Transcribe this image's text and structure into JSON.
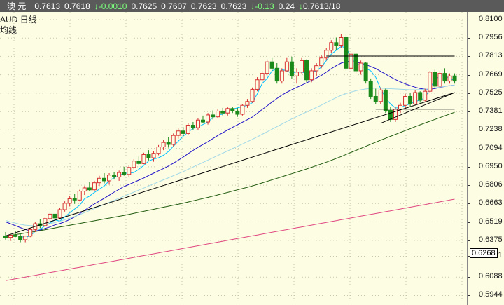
{
  "topbar": {
    "symbol": "澳 元",
    "values": [
      "0.7613",
      "0.7618"
    ],
    "change": "-0.0010",
    "values2": [
      "0.7625",
      "0.7607",
      "0.7623",
      "0.7623"
    ],
    "change2": "-0.13",
    "pct": "0.24",
    "last": "0.7613/18"
  },
  "legend": {
    "line1": "AUD 日线",
    "line2": "均线"
  },
  "colors": {
    "background": "#fdfde4",
    "grid": "#c8c8a8",
    "up": "#d83030",
    "down": "#1a8a1a",
    "ma_fast": "#00c0ff",
    "ma_mid": "#1e10c8",
    "ma_light": "#9fd8e8",
    "ma_slow": "#225c10",
    "ma_longest": "#e04880"
  },
  "current_price": "0.6268",
  "chart_data": {
    "type": "candlestick",
    "yaxis": {
      "ticks": [
        "0.8100",
        "0.7956",
        "0.7813",
        "0.7669",
        "0.7525",
        "0.7381",
        "0.7238",
        "0.7094",
        "0.6950",
        "0.6806",
        "0.6663",
        "0.6519",
        "0.6375",
        "0.6251",
        "0.6088",
        "0.5944"
      ],
      "range": [
        0.587,
        0.816
      ]
    },
    "series": [
      {
        "values": [
          0.6402,
          0.6408,
          0.6415,
          0.6405,
          0.6398,
          0.641,
          0.6445,
          0.646,
          0.649,
          0.651,
          0.6535,
          0.6525,
          0.656,
          0.659,
          0.662,
          0.665,
          0.67,
          0.672,
          0.675,
          0.6775,
          0.68,
          0.684,
          0.6865,
          0.688,
          0.69,
          0.69,
          0.6905,
          0.693,
          0.696,
          0.6995,
          0.701,
          0.702,
          0.704,
          0.707,
          0.711,
          0.715,
          0.719,
          0.722,
          0.725,
          0.726,
          0.728,
          0.73,
          0.7335,
          0.7355,
          0.736,
          0.739,
          0.74,
          0.741,
          0.742,
          0.743,
          0.745,
          0.752,
          0.76,
          0.764,
          0.77,
          0.772,
          0.771,
          0.77,
          0.768,
          0.769,
          0.769,
          0.768,
          0.769,
          0.77,
          0.773,
          0.778,
          0.783,
          0.786,
          0.789,
          0.788,
          0.781,
          0.776,
          0.774,
          0.772,
          0.77,
          0.765,
          0.756,
          0.749,
          0.744,
          0.741,
          0.741,
          0.743,
          0.744,
          0.746,
          0.747,
          0.749,
          0.756,
          0.763,
          0.766,
          0.766,
          0.764,
          0.7625
        ]
      },
      {
        "values": [
          0.652,
          0.6505,
          0.649,
          0.6475,
          0.646,
          0.645,
          0.6448,
          0.6455,
          0.6468,
          0.648,
          0.6496,
          0.6506,
          0.652,
          0.6538,
          0.6558,
          0.6582,
          0.661,
          0.6635,
          0.666,
          0.6682,
          0.6704,
          0.6728,
          0.6752,
          0.6774,
          0.6796,
          0.6812,
          0.6828,
          0.6845,
          0.6862,
          0.6882,
          0.69,
          0.6918,
          0.6936,
          0.6956,
          0.6978,
          0.7002,
          0.7026,
          0.7052,
          0.7078,
          0.7102,
          0.7124,
          0.7146,
          0.717,
          0.7194,
          0.7216,
          0.7238,
          0.7258,
          0.7278,
          0.7298,
          0.7318,
          0.7338,
          0.7368,
          0.7398,
          0.7426,
          0.7456,
          0.7484,
          0.751,
          0.7532,
          0.7552,
          0.757,
          0.7588,
          0.7606,
          0.7624,
          0.7644,
          0.7664,
          0.769,
          0.7716,
          0.774,
          0.776,
          0.7772,
          0.7774,
          0.7768,
          0.776,
          0.7748,
          0.7734,
          0.7718,
          0.7696,
          0.7674,
          0.7652,
          0.7632,
          0.7614,
          0.7598,
          0.7584,
          0.7572,
          0.7562,
          0.7556,
          0.7556,
          0.7562,
          0.757,
          0.7578,
          0.7584,
          0.7588
        ]
      },
      {
        "values": [
          0.653,
          0.652,
          0.651,
          0.65,
          0.6494,
          0.649,
          0.649,
          0.6492,
          0.6498,
          0.6505,
          0.6514,
          0.6524,
          0.6536,
          0.6548,
          0.6562,
          0.6576,
          0.6592,
          0.6608,
          0.6624,
          0.664,
          0.6656,
          0.6672,
          0.6688,
          0.6704,
          0.672,
          0.6736,
          0.6752,
          0.6768,
          0.6784,
          0.68,
          0.6816,
          0.6832,
          0.6848,
          0.6864,
          0.688,
          0.6896,
          0.6912,
          0.693,
          0.6948,
          0.6966,
          0.6984,
          0.7002,
          0.702,
          0.7038,
          0.7056,
          0.7074,
          0.7092,
          0.711,
          0.7128,
          0.7146,
          0.7164,
          0.7184,
          0.7204,
          0.7224,
          0.7244,
          0.7264,
          0.7284,
          0.7304,
          0.7324,
          0.7342,
          0.736,
          0.7378,
          0.7396,
          0.7414,
          0.7432,
          0.7452,
          0.7472,
          0.749,
          0.7508,
          0.7522,
          0.7534,
          0.7544,
          0.7552,
          0.7558,
          0.7562,
          0.7564,
          0.7564,
          0.7562,
          0.756,
          0.7558,
          0.7556,
          0.7554,
          0.7552,
          0.7552,
          0.7554,
          0.7556,
          0.756,
          0.7566,
          0.7572,
          0.7578,
          0.7584,
          0.7588
        ]
      },
      {
        "values": [
          0.641,
          0.6415,
          0.642,
          0.6426,
          0.6432,
          0.6438,
          0.6444,
          0.6451,
          0.6458,
          0.6465,
          0.6472,
          0.6479,
          0.6486,
          0.6493,
          0.65,
          0.6507,
          0.6514,
          0.6521,
          0.6528,
          0.6535,
          0.6542,
          0.6549,
          0.6556,
          0.6563,
          0.657,
          0.6578,
          0.6586,
          0.6594,
          0.6602,
          0.661,
          0.6618,
          0.6626,
          0.6634,
          0.6642,
          0.665,
          0.6658,
          0.6666,
          0.6675,
          0.6684,
          0.6693,
          0.6702,
          0.6711,
          0.672,
          0.673,
          0.674,
          0.675,
          0.676,
          0.677,
          0.678,
          0.679,
          0.68,
          0.6812,
          0.6824,
          0.6836,
          0.6848,
          0.686,
          0.6872,
          0.6884,
          0.6896,
          0.6908,
          0.692,
          0.6933,
          0.6946,
          0.6959,
          0.6972,
          0.6986,
          0.7,
          0.7015,
          0.703,
          0.7046,
          0.7062,
          0.7078,
          0.7094,
          0.711,
          0.7126,
          0.7142,
          0.7158,
          0.7173,
          0.7188,
          0.7203,
          0.7218,
          0.7233,
          0.7248,
          0.7263,
          0.7278,
          0.7292,
          0.7306,
          0.732,
          0.7334,
          0.7348,
          0.7362,
          0.7376
        ]
      },
      {
        "values": [
          0.606,
          0.6067,
          0.6074,
          0.6081,
          0.6088,
          0.6095,
          0.6102,
          0.6109,
          0.6116,
          0.6123,
          0.613,
          0.6137,
          0.6144,
          0.6151,
          0.6158,
          0.6165,
          0.6172,
          0.6179,
          0.6186,
          0.6193,
          0.62,
          0.6207,
          0.6214,
          0.6221,
          0.6228,
          0.6235,
          0.6242,
          0.6249,
          0.6256,
          0.6263,
          0.627,
          0.6277,
          0.6284,
          0.6291,
          0.6298,
          0.6305,
          0.6312,
          0.6319,
          0.6326,
          0.6333,
          0.634,
          0.6347,
          0.6354,
          0.6361,
          0.6368,
          0.6375,
          0.6382,
          0.6389,
          0.6396,
          0.6403,
          0.641,
          0.6417,
          0.6424,
          0.6431,
          0.6438,
          0.6445,
          0.6452,
          0.6459,
          0.6466,
          0.6473,
          0.648,
          0.6487,
          0.6494,
          0.6501,
          0.6508,
          0.6515,
          0.6522,
          0.6529,
          0.6536,
          0.6543,
          0.655,
          0.6557,
          0.6564,
          0.6571,
          0.6578,
          0.6585,
          0.6592,
          0.6599,
          0.6606,
          0.6613,
          0.662,
          0.6627,
          0.6634,
          0.6641,
          0.6648,
          0.6655,
          0.6662,
          0.6669,
          0.6676,
          0.6683,
          0.669,
          0.6697
        ]
      }
    ],
    "candles": [
      [
        0.641,
        0.644,
        0.638,
        0.6398
      ],
      [
        0.6398,
        0.642,
        0.637,
        0.6415
      ],
      [
        0.6415,
        0.645,
        0.64,
        0.6405
      ],
      [
        0.6405,
        0.643,
        0.636,
        0.638
      ],
      [
        0.638,
        0.641,
        0.636,
        0.6408
      ],
      [
        0.6408,
        0.647,
        0.64,
        0.646
      ],
      [
        0.646,
        0.652,
        0.644,
        0.6505
      ],
      [
        0.6505,
        0.654,
        0.647,
        0.649
      ],
      [
        0.649,
        0.656,
        0.648,
        0.6545
      ],
      [
        0.6545,
        0.66,
        0.652,
        0.658
      ],
      [
        0.658,
        0.661,
        0.653,
        0.655
      ],
      [
        0.655,
        0.663,
        0.654,
        0.6615
      ],
      [
        0.6615,
        0.668,
        0.66,
        0.6665
      ],
      [
        0.6665,
        0.672,
        0.664,
        0.67
      ],
      [
        0.67,
        0.674,
        0.666,
        0.669
      ],
      [
        0.669,
        0.677,
        0.668,
        0.676
      ],
      [
        0.676,
        0.68,
        0.673,
        0.6785
      ],
      [
        0.6785,
        0.683,
        0.676,
        0.677
      ],
      [
        0.677,
        0.684,
        0.676,
        0.6825
      ],
      [
        0.6825,
        0.688,
        0.68,
        0.686
      ],
      [
        0.686,
        0.69,
        0.682,
        0.684
      ],
      [
        0.684,
        0.69,
        0.681,
        0.6885
      ],
      [
        0.6885,
        0.691,
        0.685,
        0.687
      ],
      [
        0.687,
        0.692,
        0.684,
        0.6905
      ],
      [
        0.6905,
        0.695,
        0.688,
        0.689
      ],
      [
        0.689,
        0.696,
        0.687,
        0.6945
      ],
      [
        0.6945,
        0.701,
        0.693,
        0.6995
      ],
      [
        0.6995,
        0.703,
        0.696,
        0.6975
      ],
      [
        0.6975,
        0.706,
        0.697,
        0.7045
      ],
      [
        0.7045,
        0.708,
        0.7,
        0.702
      ],
      [
        0.702,
        0.707,
        0.699,
        0.7055
      ],
      [
        0.7055,
        0.712,
        0.704,
        0.7105
      ],
      [
        0.7105,
        0.716,
        0.708,
        0.714
      ],
      [
        0.714,
        0.718,
        0.71,
        0.7125
      ],
      [
        0.7125,
        0.721,
        0.711,
        0.7195
      ],
      [
        0.7195,
        0.725,
        0.717,
        0.723
      ],
      [
        0.723,
        0.726,
        0.719,
        0.721
      ],
      [
        0.721,
        0.729,
        0.72,
        0.7275
      ],
      [
        0.7275,
        0.73,
        0.724,
        0.7255
      ],
      [
        0.7255,
        0.733,
        0.724,
        0.7315
      ],
      [
        0.7315,
        0.735,
        0.729,
        0.73
      ],
      [
        0.73,
        0.737,
        0.728,
        0.7355
      ],
      [
        0.7355,
        0.739,
        0.732,
        0.734
      ],
      [
        0.734,
        0.74,
        0.733,
        0.7385
      ],
      [
        0.7385,
        0.741,
        0.735,
        0.737
      ],
      [
        0.737,
        0.742,
        0.735,
        0.7405
      ],
      [
        0.7405,
        0.742,
        0.737,
        0.7385
      ],
      [
        0.7385,
        0.741,
        0.734,
        0.736
      ],
      [
        0.736,
        0.744,
        0.735,
        0.743
      ],
      [
        0.743,
        0.748,
        0.741,
        0.746
      ],
      [
        0.746,
        0.757,
        0.745,
        0.7555
      ],
      [
        0.7555,
        0.765,
        0.754,
        0.763
      ],
      [
        0.763,
        0.77,
        0.76,
        0.768
      ],
      [
        0.768,
        0.779,
        0.766,
        0.777
      ],
      [
        0.777,
        0.78,
        0.77,
        0.772
      ],
      [
        0.772,
        0.776,
        0.76,
        0.762
      ],
      [
        0.762,
        0.772,
        0.76,
        0.77
      ],
      [
        0.77,
        0.78,
        0.769,
        0.777
      ],
      [
        0.777,
        0.781,
        0.764,
        0.766
      ],
      [
        0.766,
        0.772,
        0.76,
        0.769
      ],
      [
        0.769,
        0.78,
        0.768,
        0.778
      ],
      [
        0.778,
        0.779,
        0.761,
        0.763
      ],
      [
        0.763,
        0.772,
        0.761,
        0.77
      ],
      [
        0.77,
        0.776,
        0.766,
        0.774
      ],
      [
        0.774,
        0.782,
        0.772,
        0.78
      ],
      [
        0.78,
        0.788,
        0.778,
        0.786
      ],
      [
        0.786,
        0.794,
        0.784,
        0.792
      ],
      [
        0.792,
        0.796,
        0.786,
        0.79
      ],
      [
        0.79,
        0.799,
        0.788,
        0.796
      ],
      [
        0.796,
        0.799,
        0.77,
        0.772
      ],
      [
        0.772,
        0.785,
        0.769,
        0.783
      ],
      [
        0.783,
        0.784,
        0.768,
        0.77
      ],
      [
        0.77,
        0.778,
        0.767,
        0.776
      ],
      [
        0.776,
        0.777,
        0.76,
        0.762
      ],
      [
        0.762,
        0.764,
        0.748,
        0.75
      ],
      [
        0.75,
        0.756,
        0.744,
        0.746
      ],
      [
        0.746,
        0.757,
        0.744,
        0.755
      ],
      [
        0.755,
        0.756,
        0.737,
        0.739
      ],
      [
        0.739,
        0.742,
        0.73,
        0.732
      ],
      [
        0.732,
        0.742,
        0.73,
        0.74
      ],
      [
        0.74,
        0.745,
        0.737,
        0.743
      ],
      [
        0.743,
        0.752,
        0.74,
        0.75
      ],
      [
        0.75,
        0.753,
        0.742,
        0.744
      ],
      [
        0.744,
        0.755,
        0.743,
        0.753
      ],
      [
        0.753,
        0.754,
        0.745,
        0.747
      ],
      [
        0.747,
        0.756,
        0.746,
        0.754
      ],
      [
        0.754,
        0.77,
        0.753,
        0.769
      ],
      [
        0.769,
        0.771,
        0.756,
        0.758
      ],
      [
        0.758,
        0.77,
        0.756,
        0.768
      ],
      [
        0.768,
        0.772,
        0.76,
        0.762
      ],
      [
        0.762,
        0.768,
        0.76,
        0.766
      ],
      [
        0.766,
        0.768,
        0.76,
        0.762
      ]
    ],
    "lines": [
      {
        "kind": "hline",
        "price": 0.7815,
        "from": 65,
        "to": 91
      },
      {
        "kind": "hline",
        "price": 0.74,
        "from": 75,
        "to": 91
      },
      {
        "kind": "trend",
        "p1": [
          0,
          0.641
        ],
        "p2": [
          91,
          0.753
        ]
      },
      {
        "kind": "trend",
        "p1": [
          76,
          0.729
        ],
        "p2": [
          91,
          0.753
        ]
      }
    ]
  }
}
